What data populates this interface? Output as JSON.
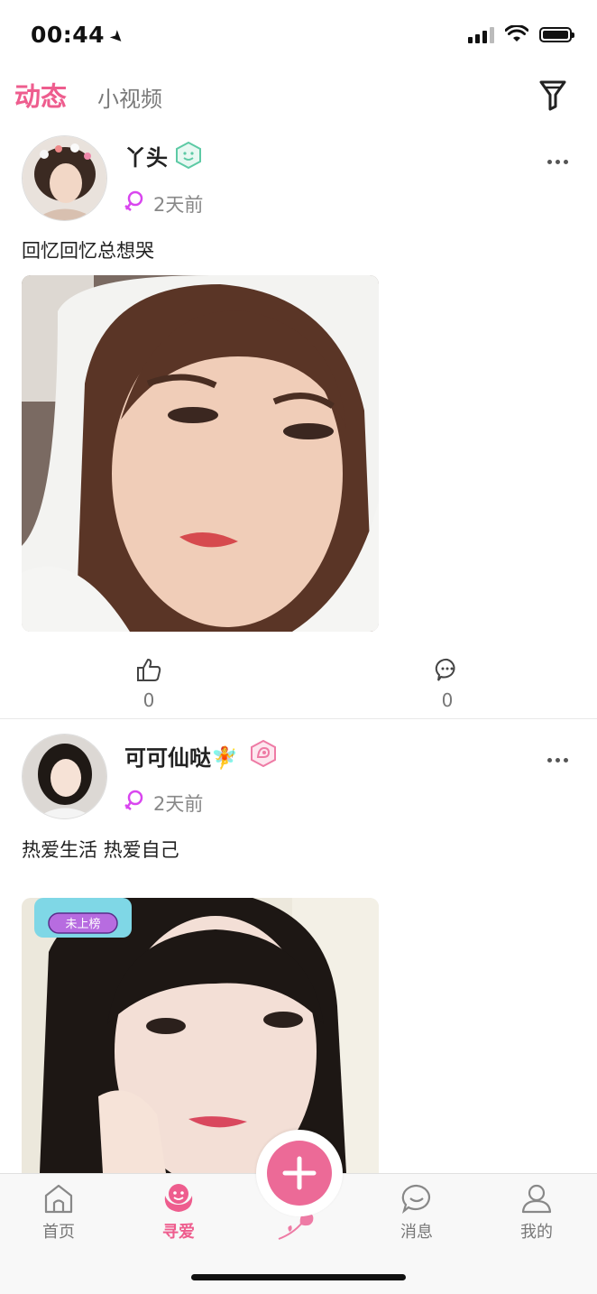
{
  "status_bar": {
    "time": "00:44"
  },
  "header": {
    "tab_active": "动态",
    "tab_video": "小视频"
  },
  "posts": [
    {
      "username": "丫头",
      "time": "2天前",
      "text": "回忆回忆总想哭",
      "likes": "0",
      "comments": "0"
    },
    {
      "username": "可可仙哒🧚",
      "time": "2天前",
      "text": "热爱生活 热爱自己",
      "photo_badge": "未上榜"
    }
  ],
  "bottom_nav": {
    "home": "首页",
    "seek_love": "寻爱",
    "messages": "消息",
    "mine": "我的"
  },
  "colors": {
    "accent": "#ee5d8e",
    "badge_green": "#5dcaa5"
  }
}
